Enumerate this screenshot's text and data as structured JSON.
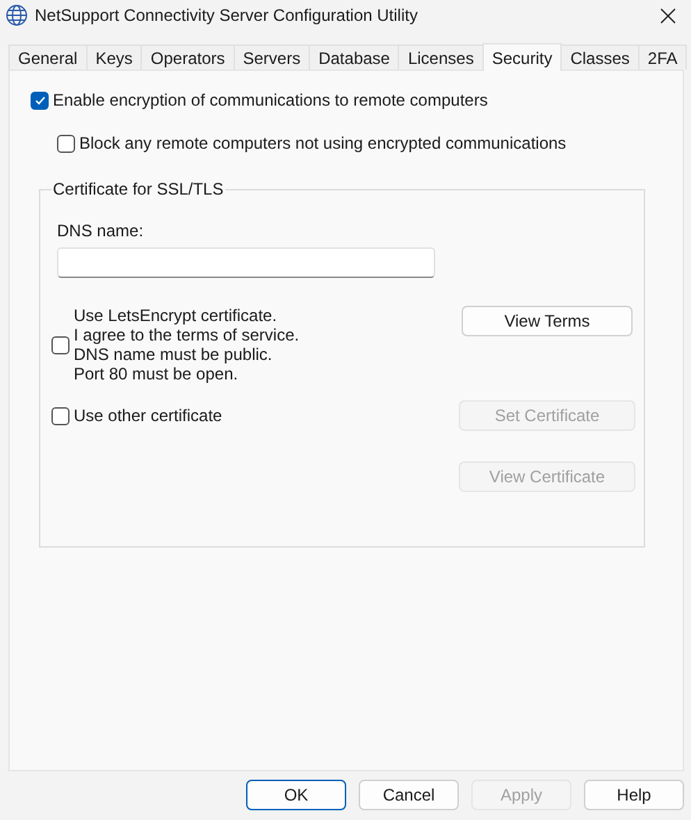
{
  "window": {
    "title": "NetSupport Connectivity Server Configuration Utility"
  },
  "tabs": [
    {
      "label": "General",
      "selected": false
    },
    {
      "label": "Keys",
      "selected": false
    },
    {
      "label": "Operators",
      "selected": false
    },
    {
      "label": "Servers",
      "selected": false
    },
    {
      "label": "Database",
      "selected": false
    },
    {
      "label": "Licenses",
      "selected": false
    },
    {
      "label": "Security",
      "selected": true
    },
    {
      "label": "Classes",
      "selected": false
    },
    {
      "label": "2FA",
      "selected": false
    }
  ],
  "options": [
    {
      "label": "Enable encryption of communications to remote computers",
      "checked": true,
      "children": [
        {
          "label": "Block any remote computers not using encrypted communications",
          "checked": false
        }
      ]
    }
  ],
  "certificate_group": {
    "title": "Certificate for SSL/TLS",
    "dns_name": {
      "label": "DNS name:"
    },
    "letsencrypt": {
      "label": "Use LetsEncrypt certificate.\nI agree to the terms of service.\nDNS name must be public.\nPort 80 must be open.",
      "checked": false
    },
    "view_terms": {
      "label": "View Terms",
      "disabled": false
    },
    "other_certificate": {
      "label": "Use other certificate",
      "checked": false
    },
    "set_certificate": {
      "label": "Set Certificate",
      "disabled": true
    },
    "view_certificate": {
      "label": "View Certificate",
      "disabled": true
    }
  },
  "buttons": [
    {
      "label": "OK",
      "default": true,
      "disabled": false
    },
    {
      "label": "Cancel",
      "default": false,
      "disabled": false
    },
    {
      "label": "Apply",
      "default": false,
      "disabled": true
    },
    {
      "label": "Help",
      "default": false,
      "disabled": false
    }
  ]
}
